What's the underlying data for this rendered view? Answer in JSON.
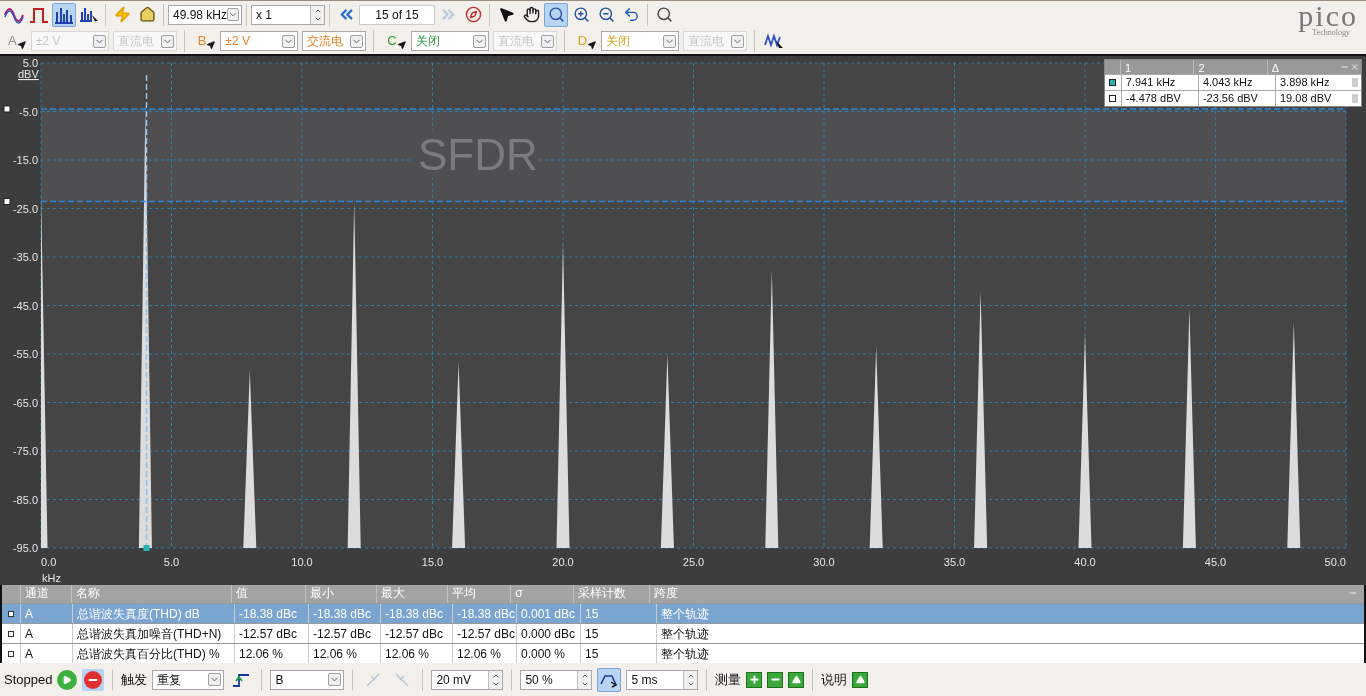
{
  "toolbar": {
    "view_tools": [
      {
        "kind": "scope",
        "selected": false
      },
      {
        "kind": "persistence",
        "selected": false
      },
      {
        "kind": "spectrum",
        "selected": true
      },
      {
        "kind": "spectrum-new",
        "selected": false
      }
    ],
    "sample_rate": "49.98 kHz",
    "zoom_factor": "x 1",
    "buffer": "15 of 15",
    "buffer_next_disabled": true,
    "pointer_tools": [
      {
        "kind": "pointer",
        "selected": false
      },
      {
        "kind": "hand",
        "selected": false
      },
      {
        "kind": "zoom-area",
        "selected": true
      },
      {
        "kind": "zoom-in",
        "selected": false
      },
      {
        "kind": "zoom-out",
        "selected": false
      },
      {
        "kind": "undo",
        "selected": false
      }
    ]
  },
  "channels": [
    {
      "letter": "A",
      "color": "#8f8f8f",
      "range": "±2 V",
      "range_disabled": true,
      "coupling": "直流电",
      "coupling_disabled": true
    },
    {
      "letter": "B",
      "color": "#e8822a",
      "range": "±2 V",
      "range_disabled": false,
      "coupling": "交流电",
      "coupling_disabled": false
    },
    {
      "letter": "C",
      "color": "#2e9a3a",
      "range": "关闭",
      "range_disabled": false,
      "coupling": "直流电",
      "coupling_disabled": true
    },
    {
      "letter": "D",
      "color": "#d4a31c",
      "range": "关闭",
      "range_disabled": false,
      "coupling": "直流电",
      "coupling_disabled": true
    }
  ],
  "logo": {
    "name": "pico",
    "tagline": "Technology"
  },
  "plot": {
    "overlay_label": "SFDR",
    "chart_data": {
      "type": "area",
      "xlabel": "kHz",
      "ylabel": "dBV",
      "grid": true,
      "x": [
        0,
        0.25,
        3.75,
        4,
        4.25,
        7.75,
        8,
        8.25,
        11.75,
        12,
        12.25,
        15.75,
        16,
        16.25,
        19.75,
        20,
        20.25,
        23.75,
        24,
        24.25,
        27.75,
        28,
        28.25,
        31.75,
        32,
        32.25,
        35.75,
        36,
        36.25,
        39.75,
        40,
        40.25,
        43.75,
        44,
        44.25,
        47.75,
        48,
        48.25,
        50
      ],
      "values": [
        -21.6,
        -95,
        -95,
        -4.5,
        -95,
        -95,
        -58.3,
        -95,
        -95,
        -23.5,
        -95,
        -95,
        -56.6,
        -95,
        -95,
        -32.1,
        -95,
        -95,
        -55,
        -95,
        -95,
        -37.7,
        -95,
        -95,
        -53.4,
        -95,
        -95,
        -42,
        -95,
        -95,
        -50.9,
        -95,
        -95,
        -45.5,
        -95,
        -95,
        -48.4,
        -95,
        -95
      ],
      "xlim": [
        0,
        50
      ],
      "ylim": [
        -95,
        5
      ],
      "xticks": [
        {
          "value": 0,
          "label": "0.0"
        },
        {
          "value": 5,
          "label": "5.0"
        },
        {
          "value": 10,
          "label": "10.0"
        },
        {
          "value": 15,
          "label": "15.0"
        },
        {
          "value": 20,
          "label": "20.0"
        },
        {
          "value": 25,
          "label": "25.0"
        },
        {
          "value": 30,
          "label": "30.0"
        },
        {
          "value": 35,
          "label": "35.0"
        },
        {
          "value": 40,
          "label": "40.0"
        },
        {
          "value": 45,
          "label": "45.0"
        },
        {
          "value": 50,
          "label": "50.0"
        }
      ],
      "yticks": [
        {
          "value": 5,
          "label": "5.0"
        },
        {
          "value": -5,
          "label": "-5.0"
        },
        {
          "value": -15,
          "label": "-15.0"
        },
        {
          "value": -25,
          "label": "-25.0"
        },
        {
          "value": -35,
          "label": "-35.0"
        },
        {
          "value": -45,
          "label": "-45.0"
        },
        {
          "value": -55,
          "label": "-55.0"
        },
        {
          "value": -65,
          "label": "-65.0"
        },
        {
          "value": -75,
          "label": "-75.0"
        },
        {
          "value": -85,
          "label": "-85.0"
        },
        {
          "value": -95,
          "label": "-95.0"
        }
      ],
      "ref_lines": [
        {
          "axis": "y",
          "value": -4.478
        },
        {
          "axis": "y",
          "value": -23.56
        },
        {
          "axis": "x",
          "value": 4.043
        }
      ],
      "bands": [
        {
          "axis": "y",
          "from": -23.56,
          "to": -4.478
        }
      ]
    }
  },
  "cursor_table": {
    "columns": [
      "1",
      "2",
      "Δ"
    ],
    "rows": [
      {
        "values": [
          "7.941 kHz",
          "4.043 kHz",
          "3.898 kHz"
        ]
      },
      {
        "values": [
          "-4.478 dBV",
          "-23.56 dBV",
          "19.08 dBV"
        ]
      }
    ]
  },
  "measurements": {
    "columns": [
      "通道",
      "名称",
      "值",
      "最小",
      "最大",
      "平均",
      "σ",
      "采样计数",
      "跨度"
    ],
    "rows": [
      {
        "selected": true,
        "cells": [
          "A",
          "总谐波失真度(THD) dB",
          "-18.38 dBc",
          "-18.38 dBc",
          "-18.38 dBc",
          "-18.38 dBc",
          "0.001 dBc",
          "15",
          "整个轨迹"
        ]
      },
      {
        "selected": false,
        "cells": [
          "A",
          "总谐波失真加噪音(THD+N)",
          "-12.57 dBc",
          "-12.57 dBc",
          "-12.57 dBc",
          "-12.57 dBc",
          "0.000 dBc",
          "15",
          "整个轨迹"
        ]
      },
      {
        "selected": false,
        "cells": [
          "A",
          "总谐波失真百分比(THD) %",
          "12.06 %",
          "12.06 %",
          "12.06 %",
          "12.06 %",
          "0.000 %",
          "15",
          "整个轨迹"
        ]
      }
    ]
  },
  "status_bar": {
    "state": "Stopped",
    "running": false,
    "trigger_label": "触发",
    "trigger_mode": "重复",
    "trigger_source": "B",
    "threshold": "20 mV",
    "pretrigger": "50 %",
    "delay": "5 ms",
    "measure_label": "测量",
    "notes_label": "说明"
  }
}
